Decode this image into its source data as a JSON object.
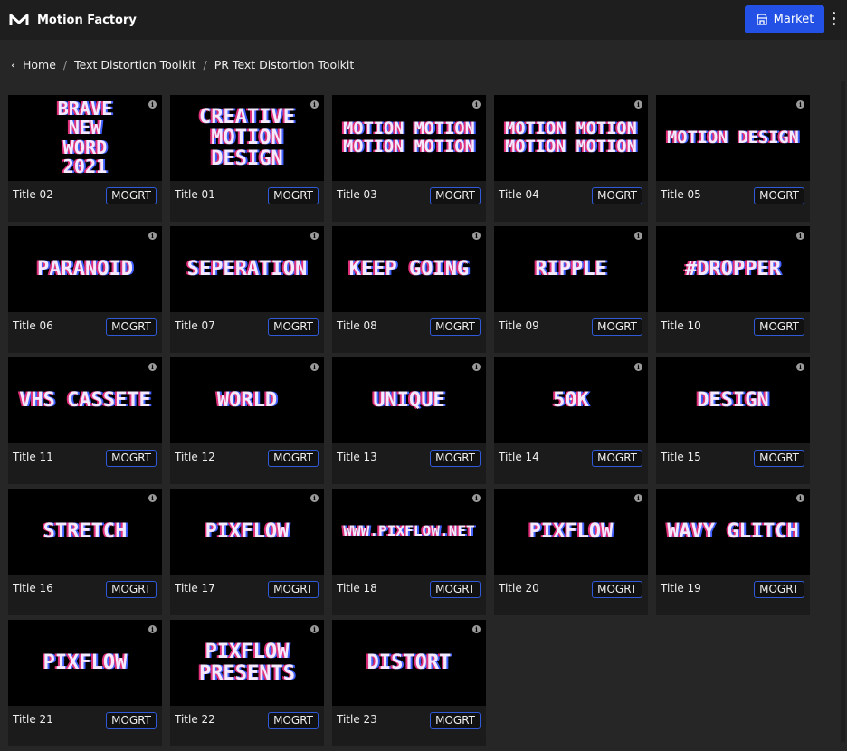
{
  "header": {
    "app_title": "Motion Factory",
    "market_label": "Market",
    "icons": [
      "motion-factory-logo",
      "store-icon",
      "more-vertical-icon"
    ]
  },
  "breadcrumb": [
    "Home",
    "Text Distortion Toolkit",
    "PR Text Distortion Toolkit"
  ],
  "button_label": "MOGRT",
  "cards": [
    {
      "title": "Title 02",
      "art": "BRAVE\nNEW\nWORD\n2021"
    },
    {
      "title": "Title 01",
      "art": "CREATIVE\nMOTION\nDESIGN"
    },
    {
      "title": "Title 03",
      "art": "MOTION MOTION\nMOTION MOTION"
    },
    {
      "title": "Title 04",
      "art": "MOTION MOTION\nMOTION MOTION"
    },
    {
      "title": "Title 05",
      "art": "MOTION DESIGN"
    },
    {
      "title": "Title 06",
      "art": "PARANOID"
    },
    {
      "title": "Title 07",
      "art": "SEPERATION"
    },
    {
      "title": "Title 08",
      "art": "KEEP GOING"
    },
    {
      "title": "Title 09",
      "art": "RIPPLE"
    },
    {
      "title": "Title 10",
      "art": "#DROPPER"
    },
    {
      "title": "Title 11",
      "art": "VHS CASSETE"
    },
    {
      "title": "Title 12",
      "art": "WORLD"
    },
    {
      "title": "Title 13",
      "art": "UNIQUE"
    },
    {
      "title": "Title 14",
      "art": "50K"
    },
    {
      "title": "Title 15",
      "art": "DESIGN"
    },
    {
      "title": "Title 16",
      "art": "STRETCH"
    },
    {
      "title": "Title 17",
      "art": "PIXFLOW"
    },
    {
      "title": "Title 18",
      "art": "WWW.PIXFLOW.NET"
    },
    {
      "title": "Title 20",
      "art": "PIXFLOW"
    },
    {
      "title": "Title 19",
      "art": "WAVY GLITCH"
    },
    {
      "title": "Title 21",
      "art": "PIXFLOW"
    },
    {
      "title": "Title 22",
      "art": "PIXFLOW\nPRESENTS"
    },
    {
      "title": "Title 23",
      "art": "DISTORT"
    }
  ]
}
